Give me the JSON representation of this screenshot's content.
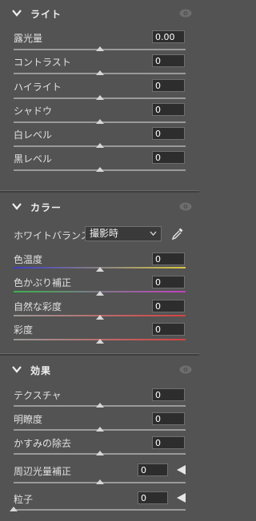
{
  "light": {
    "title": "ライト",
    "sliders": [
      {
        "label": "露光量",
        "value": "0.00",
        "level": 0.5
      },
      {
        "label": "コントラスト",
        "value": "0",
        "level": 0.5
      },
      {
        "label": "ハイライト",
        "value": "0",
        "level": 0.5
      },
      {
        "label": "シャドウ",
        "value": "0",
        "level": 0.5
      },
      {
        "label": "白レベル",
        "value": "0",
        "level": 0.5
      },
      {
        "label": "黒レベル",
        "value": "0",
        "level": 0.5
      }
    ]
  },
  "color": {
    "title": "カラー",
    "white_balance_label": "ホワイトバランス",
    "white_balance_value": "撮影時",
    "sliders": [
      {
        "label": "色温度",
        "value": "0",
        "level": 0.5,
        "gradient": [
          "#3c3cc8",
          "#d8c840"
        ]
      },
      {
        "label": "色かぶり補正",
        "value": "0",
        "level": 0.5,
        "gradient": [
          "#3cb050",
          "#c040c0"
        ]
      },
      {
        "label": "自然な彩度",
        "value": "0",
        "level": 0.5,
        "gradient": [
          "#9a9a9a",
          "#d84040"
        ]
      },
      {
        "label": "彩度",
        "value": "0",
        "level": 0.5,
        "gradient": [
          "#9a9a9a",
          "#d84040"
        ]
      }
    ]
  },
  "effects": {
    "title": "効果",
    "sliders": [
      {
        "label": "テクスチャ",
        "value": "0",
        "level": 0.5
      },
      {
        "label": "明瞭度",
        "value": "0",
        "level": 0.5
      },
      {
        "label": "かすみの除去",
        "value": "0",
        "level": 0.5
      },
      {
        "label": "周辺光量補正",
        "value": "0",
        "level": 0.5
      },
      {
        "label": "粒子",
        "value": "0",
        "level": 0.0
      }
    ]
  },
  "colors": {
    "background": "#535353",
    "field": "#2d2d2d",
    "text": "#e0e0e0"
  }
}
